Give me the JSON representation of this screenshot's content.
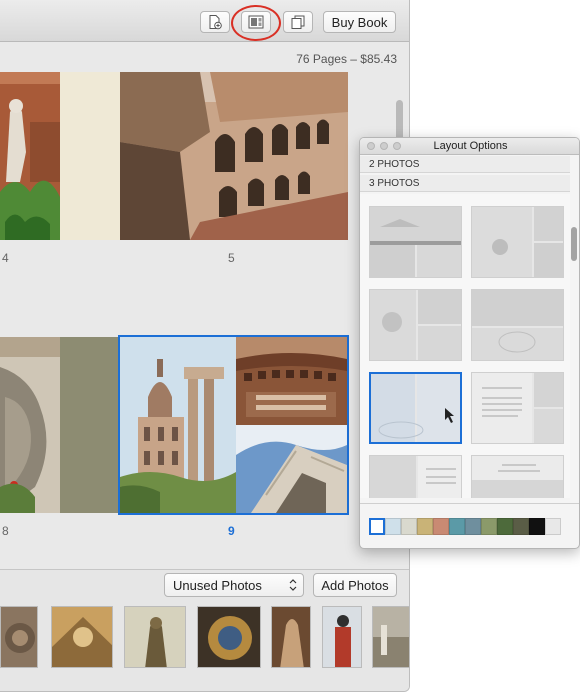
{
  "toolbar": {
    "buy_book_label": "Buy Book",
    "add_page_icon": "add-page-icon",
    "layout_icon": "layout-options-icon",
    "pages_icon": "pages-icon"
  },
  "book": {
    "page_count_price": "76 Pages – $85.43",
    "spreads": [
      {
        "page_label": "5"
      },
      {
        "page_label": "9",
        "selected": true
      }
    ],
    "partial_left_label_top": "4",
    "partial_left_label_bottom": "8"
  },
  "bottom": {
    "photo_filter_selected": "Unused Photos",
    "add_photos_label": "Add Photos"
  },
  "layout_panel": {
    "title": "Layout Options",
    "categories": [
      "2 PHOTOS",
      "3 PHOTOS"
    ],
    "swatches": [
      "#ffffff",
      "#cfe0ea",
      "#d9d9ce",
      "#c9b377",
      "#c98a73",
      "#5b9aa7",
      "#6f8f9e",
      "#8b9a6a",
      "#4d6a3b",
      "#5a5d46",
      "#111111",
      "#e8e8e8"
    ]
  },
  "colors": {
    "accent": "#1c6fd6",
    "highlight_ring": "#d93025"
  }
}
